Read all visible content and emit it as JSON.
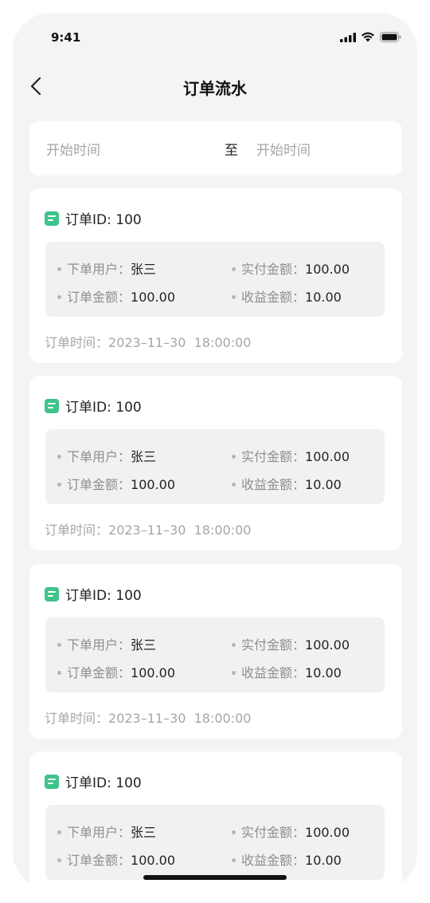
{
  "status_bar": {
    "time": "9:41"
  },
  "nav": {
    "title": "订单流水"
  },
  "date_range": {
    "start_placeholder": "开始时间",
    "separator": "至",
    "end_placeholder": "开始时间"
  },
  "labels": {
    "order_id": "订单ID: ",
    "user": "下单用户：",
    "paid": "实付金额：",
    "amount": "订单金额：",
    "profit": "收益金额：",
    "time": "订单时间："
  },
  "orders": [
    {
      "id": "100",
      "user": "张三",
      "paid": "100.00",
      "amount": "100.00",
      "profit": "10.00",
      "time": "2023–11–30  18:00:00"
    },
    {
      "id": "100",
      "user": "张三",
      "paid": "100.00",
      "amount": "100.00",
      "profit": "10.00",
      "time": "2023–11–30  18:00:00"
    },
    {
      "id": "100",
      "user": "张三",
      "paid": "100.00",
      "amount": "100.00",
      "profit": "10.00",
      "time": "2023–11–30  18:00:00"
    },
    {
      "id": "100",
      "user": "张三",
      "paid": "100.00",
      "amount": "100.00",
      "profit": "10.00",
      "time": ""
    }
  ],
  "icons": {
    "back": "chevron-left-icon",
    "order": "document-icon",
    "signal": "cellular-signal-icon",
    "wifi": "wifi-icon",
    "battery": "battery-icon"
  },
  "colors": {
    "accent": "#3ec38a",
    "background": "#f3f4f5",
    "card": "#ffffff",
    "detail_bg": "#f0f2f2"
  }
}
